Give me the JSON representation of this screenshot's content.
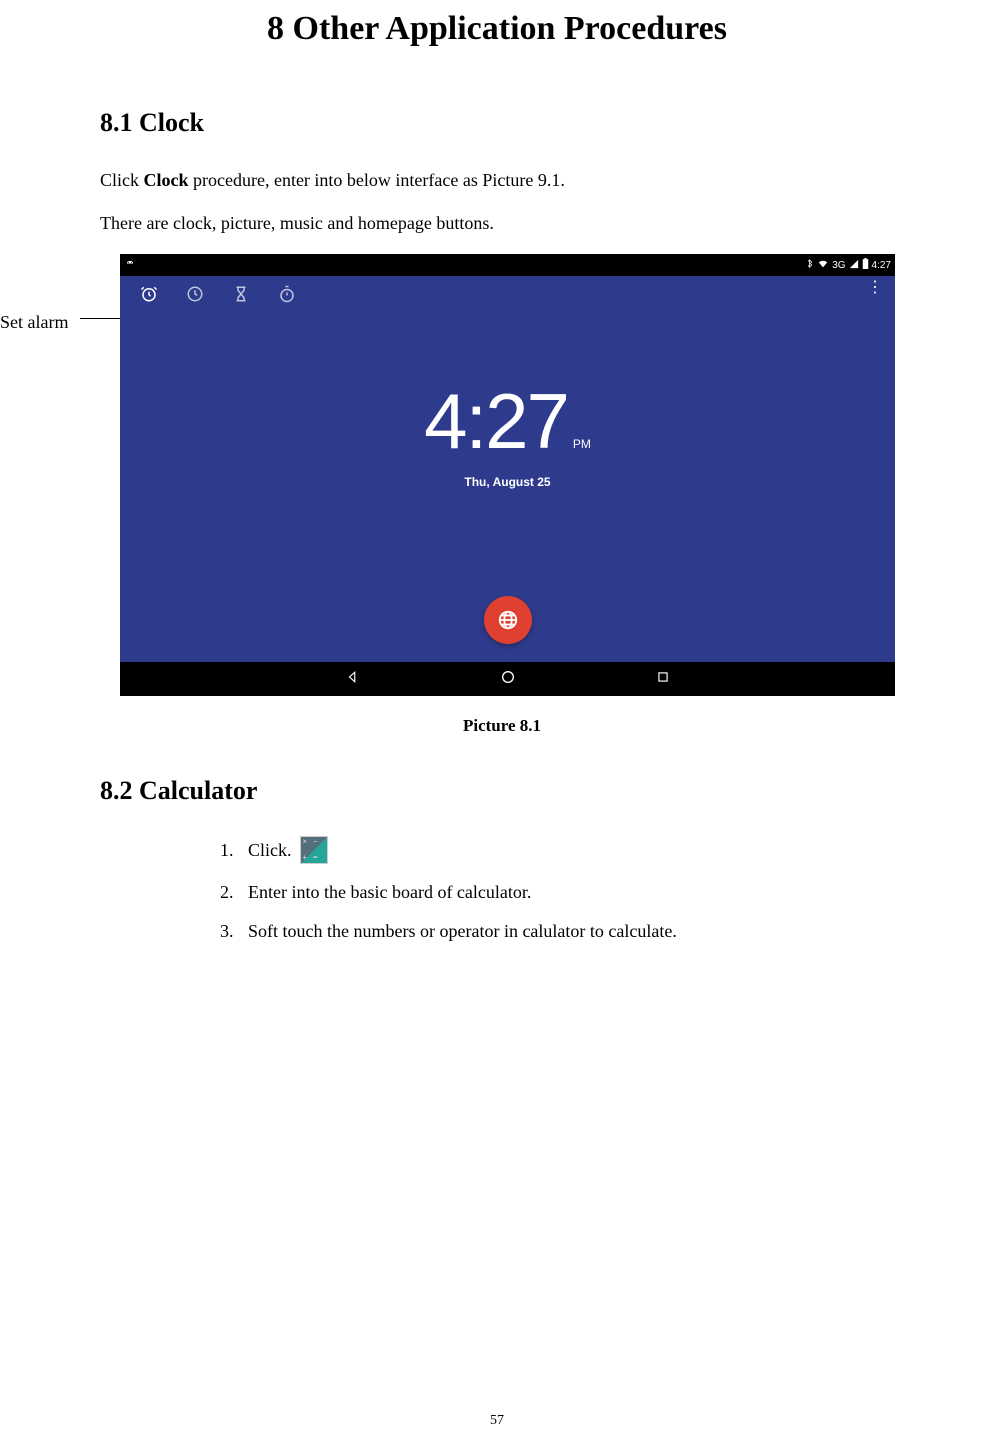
{
  "page": {
    "title": "8 Other Application Procedures",
    "number": "57"
  },
  "section_8_1": {
    "header": "8.1  Clock",
    "para1_prefix": "Click ",
    "para1_bold": "Clock",
    "para1_suffix": " procedure, enter into below interface as Picture 9.1.",
    "para2": "There are clock, picture, music and homepage buttons.",
    "annotation": "Set alarm",
    "figure_caption": "Picture 8.1"
  },
  "screenshot": {
    "status": {
      "signal": "3G",
      "time": "4:27"
    },
    "clock": {
      "time": "4:27",
      "ampm": "PM",
      "date": "Thu, August 25"
    }
  },
  "section_8_2": {
    "header": "8.2  Calculator",
    "items": [
      {
        "num": "1.",
        "text": "Click."
      },
      {
        "num": "2.",
        "text": "Enter into the basic board of calculator."
      },
      {
        "num": "3.",
        "text": "Soft touch the numbers or operator in calulator to calculate."
      }
    ]
  }
}
